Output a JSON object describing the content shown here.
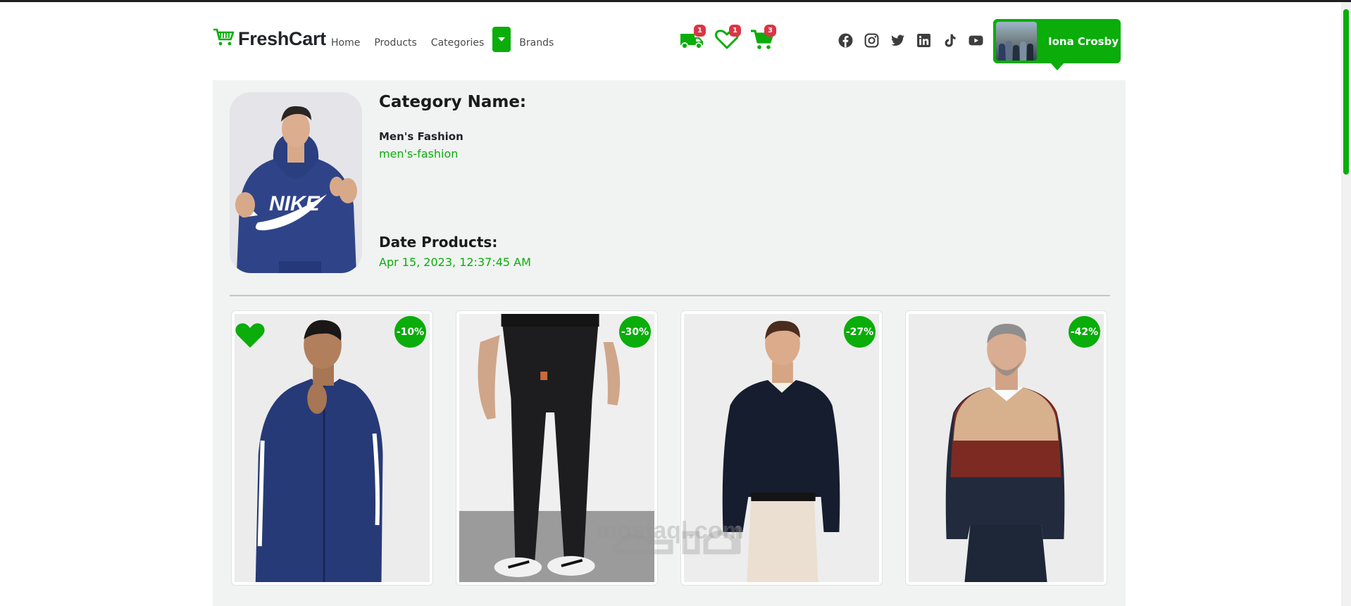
{
  "brand": {
    "name": "FreshCart",
    "icon": "cart-icon",
    "accent": "#0aad0a"
  },
  "nav": {
    "links": [
      {
        "label": "Home"
      },
      {
        "label": "Products"
      },
      {
        "label": "Categories"
      },
      {
        "label": "Brands"
      }
    ],
    "dropdown_icon": "caret-down-icon"
  },
  "nav_icons": [
    {
      "name": "truck-icon",
      "badge": "1"
    },
    {
      "name": "heart-icon",
      "badge": "1"
    },
    {
      "name": "cart-icon",
      "badge": "3"
    }
  ],
  "social_icons": [
    "facebook-icon",
    "instagram-icon",
    "twitter-icon",
    "linkedin-icon",
    "tiktok-icon",
    "youtube-icon"
  ],
  "user": {
    "name": "Iona Crosby"
  },
  "category": {
    "heading": "Category Name:",
    "name": "Men's Fashion",
    "slug": "men's-fashion",
    "date_heading": "Date Products:",
    "date": "Apr 15, 2023, 12:37:45 AM"
  },
  "products": [
    {
      "discount": "-10%",
      "wishlisted": true
    },
    {
      "discount": "-30%",
      "wishlisted": false
    },
    {
      "discount": "-27%",
      "wishlisted": false
    },
    {
      "discount": "-42%",
      "wishlisted": false
    }
  ],
  "watermark": {
    "latin": "mostaql.com"
  },
  "colors": {
    "accent": "#0aad0a",
    "badge": "#dc3545",
    "page_bg": "#f0f3f2"
  }
}
